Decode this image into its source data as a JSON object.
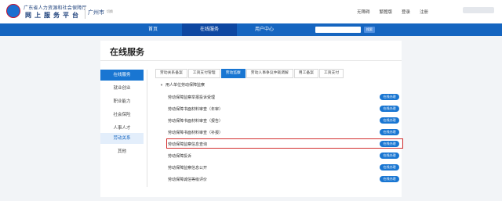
{
  "header": {
    "org_line1": "广东省人力资源和社会保障厅",
    "org_line2": "网上服务平台",
    "city": "广州市",
    "city_switch": "切换",
    "links": [
      "无障碍",
      "繁體版",
      "登录",
      "注册"
    ]
  },
  "nav": {
    "items": [
      "首页",
      "在线服务",
      "用户中心"
    ],
    "active_index": 1,
    "search_button": "搜索"
  },
  "page": {
    "title": "在线服务"
  },
  "sidebar": {
    "items": [
      {
        "label": "在线服务",
        "state": "active"
      },
      {
        "label": "就业创业",
        "state": "normal"
      },
      {
        "label": "职业能力",
        "state": "normal"
      },
      {
        "label": "社会保险",
        "state": "normal"
      },
      {
        "label": "人事人才",
        "state": "normal"
      },
      {
        "label": "劳动关系",
        "state": "current"
      },
      {
        "label": "其他",
        "state": "sub"
      }
    ]
  },
  "tabs": {
    "items": [
      "劳动关系备案",
      "工资支付管理",
      "劳动监察",
      "劳动人事争议仲裁调解",
      "用工备案",
      "工资支付"
    ],
    "active_index": 2
  },
  "section": {
    "title": "用人单位劳动保障监察"
  },
  "rows": [
    {
      "label": "劳动保障监察举报投诉受理",
      "button": "在线办理"
    },
    {
      "label": "劳动保障书面材料审查（年审）",
      "button": "在线办理"
    },
    {
      "label": "劳动保障书面材料审查（报告）",
      "button": "在线办理"
    },
    {
      "label": "劳动保障书面材料审查（补报）",
      "button": "在线办理"
    },
    {
      "label": "劳动保障监察信息查询",
      "button": "在线办理",
      "highlighted": true
    },
    {
      "label": "劳动保障投诉",
      "button": "在线办理"
    },
    {
      "label": "劳动保障监察信息公开",
      "button": "在线办理"
    },
    {
      "label": "劳动保障诚信等级评价",
      "button": "在线办理"
    }
  ]
}
